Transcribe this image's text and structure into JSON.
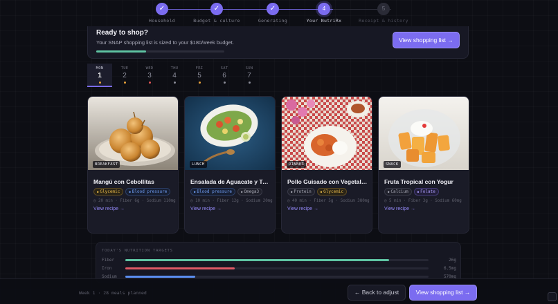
{
  "stepper": {
    "steps": [
      {
        "label": "Household",
        "mark": "✓"
      },
      {
        "label": "Budget & culture",
        "mark": "✓"
      },
      {
        "label": "Generating",
        "mark": "✓"
      },
      {
        "label": "Your NutriRx",
        "mark": "4"
      },
      {
        "label": "Receipt & history",
        "mark": "5"
      }
    ]
  },
  "banner": {
    "title": "Ready to shop?",
    "subtitle": "Your SNAP shopping list is sized to your $180/week budget.",
    "progress": 0.39,
    "button_label": "View shopping list →"
  },
  "days": [
    {
      "name": "MON",
      "num": "1",
      "dot_color": "#e8a23a"
    },
    {
      "name": "TUE",
      "num": "2",
      "dot_color": "#e8a23a"
    },
    {
      "name": "WED",
      "num": "3",
      "dot_color": "#e05656"
    },
    {
      "name": "THU",
      "num": "4",
      "dot_color": "#8b8c98"
    },
    {
      "name": "FRI",
      "num": "5",
      "dot_color": "#e8a23a"
    },
    {
      "name": "SAT",
      "num": "6",
      "dot_color": "#8b8c98"
    },
    {
      "name": "SUN",
      "num": "7",
      "dot_color": "#8b8c98"
    }
  ],
  "meals": [
    {
      "tag": "BREAKFAST",
      "title": "Mangú con Cebollitas",
      "pills": [
        {
          "text": "Glycemic",
          "style": "yellow"
        },
        {
          "text": "Blood pressure",
          "style": "blue"
        }
      ],
      "meta": "◷ 20 min · Fiber 6g · Sodium 110mg",
      "link": "View recipe →"
    },
    {
      "tag": "LUNCH",
      "title": "Ensalada de Aguacate y To...",
      "pills": [
        {
          "text": "Blood pressure",
          "style": "blue"
        },
        {
          "text": "Omega3",
          "style": "gray"
        }
      ],
      "meta": "◷ 10 min · Fiber 12g · Sodium 20mg",
      "link": "View recipe →"
    },
    {
      "tag": "DINNER",
      "title": "Pollo Guisado con Vegetales",
      "pills": [
        {
          "text": "Protein",
          "style": "gray"
        },
        {
          "text": "Glycemic",
          "style": "yellow"
        }
      ],
      "meta": "◷ 40 min · Fiber 5g · Sodium 380mg",
      "link": "View recipe →"
    },
    {
      "tag": "SNACK",
      "title": "Fruta Tropical con Yogur",
      "pills": [
        {
          "text": "Calcium",
          "style": "gray"
        },
        {
          "text": "Folate",
          "style": "purple"
        }
      ],
      "meta": "◷ 5 min · Fiber 3g · Sodium 60mg",
      "link": "View recipe →"
    }
  ],
  "targets": {
    "title": "TODAY'S NUTRITION TARGETS",
    "rows": [
      {
        "label": "Fiber",
        "value": "26g",
        "fraction": 0.87,
        "color": "#5fc4a3"
      },
      {
        "label": "Iron",
        "value": "6.5mg",
        "fraction": 0.36,
        "color": "#e05a66"
      },
      {
        "label": "Sodium",
        "value": "570mg",
        "fraction": 0.23,
        "color": "#5b8ef0"
      }
    ]
  },
  "footer": {
    "info": "Week 1 · 28 meals planned",
    "back_label": "← Back to adjust",
    "shop_label": "View shopping list →"
  }
}
